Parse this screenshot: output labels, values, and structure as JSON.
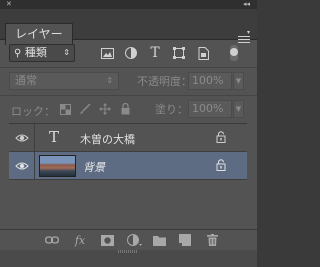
{
  "panel": {
    "tab_label": "レイヤー",
    "collapse_glyph": "◂◂",
    "close_glyph": "✕"
  },
  "filter": {
    "kind_label": "種類",
    "kind_icon": "search-icon",
    "filter_icons": [
      "pixel-layer-filter-icon",
      "adjustment-layer-filter-icon",
      "type-layer-filter-icon",
      "shape-layer-filter-icon",
      "smart-object-filter-icon"
    ]
  },
  "blend": {
    "mode": "通常",
    "opacity_label": "不透明度：",
    "opacity_value": "100%"
  },
  "lock": {
    "label": "ロック：",
    "fill_label": "塗り：",
    "fill_value": "100%",
    "icons": [
      "lock-transparent-pixels-icon",
      "lock-image-pixels-icon",
      "lock-position-icon",
      "lock-all-icon"
    ]
  },
  "layers": [
    {
      "name": "木曽の大橋",
      "type": "text",
      "type_glyph": "T",
      "visible": true,
      "locked": true,
      "selected": false
    },
    {
      "name": "背景",
      "type": "image",
      "visible": true,
      "locked": true,
      "selected": true
    }
  ],
  "bottom_icons": [
    "link-layers-icon",
    "layer-style-fx-icon",
    "add-mask-icon",
    "new-adjustment-layer-icon",
    "new-group-folder-icon",
    "new-layer-icon",
    "delete-layer-trash-icon"
  ],
  "fx_glyph": "fx",
  "colors": {
    "panel_bg": "#535353",
    "selected_row": "#5e6c83",
    "tab_bar": "#3d3d3d"
  }
}
